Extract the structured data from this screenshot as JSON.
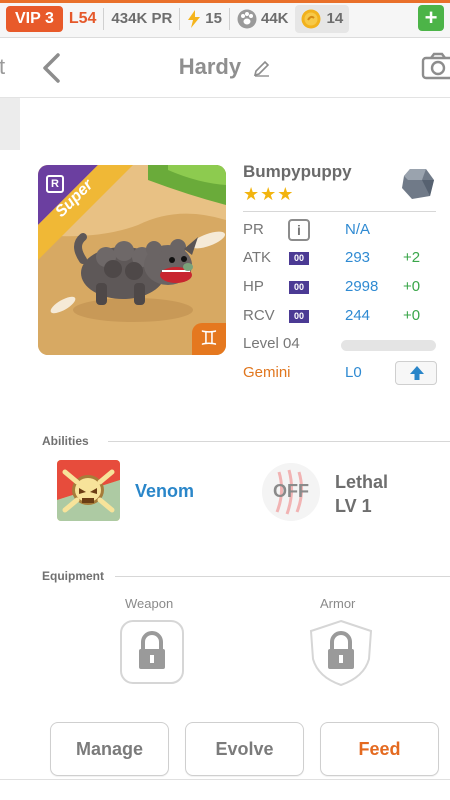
{
  "status_bar": {
    "vip_label": "VIP 3",
    "level": "L54",
    "pr": "434K PR",
    "energy": "15",
    "food": "44K",
    "coins": "14",
    "add_label": "+"
  },
  "header": {
    "partial_left": "t",
    "title": "Hardy"
  },
  "pet": {
    "badge_letter": "R",
    "rarity_label": "Super",
    "zodiac_symbol": "♊",
    "name": "Bumpypuppy",
    "stars": "★★★",
    "stats": [
      {
        "label": "PR",
        "value": "N/A",
        "bonus": ""
      },
      {
        "label": "ATK",
        "tag": "00",
        "value": "293",
        "bonus": "+2"
      },
      {
        "label": "HP",
        "tag": "00",
        "value": "2998",
        "bonus": "+0"
      },
      {
        "label": "RCV",
        "tag": "00",
        "value": "244",
        "bonus": "+0"
      }
    ],
    "level_label": "Level 04",
    "level_progress": 0.0,
    "sign_label": "Gemini",
    "sign_level": "L0",
    "info_icon_label": "i"
  },
  "abilities": {
    "heading": "Abilities",
    "items": [
      {
        "name": "Venom"
      },
      {
        "state": "OFF",
        "name": "Lethal",
        "level": "LV 1"
      }
    ]
  },
  "equipment": {
    "heading": "Equipment",
    "weapon_label": "Weapon",
    "armor_label": "Armor"
  },
  "actions": {
    "manage": "Manage",
    "evolve": "Evolve",
    "feed": "Feed"
  },
  "colors": {
    "accent_orange": "#e46a20",
    "vip_red": "#e85a2a",
    "stat_blue": "#2f8ad2",
    "bonus_green": "#3aa64a",
    "plus_green": "#4cb448",
    "tag_purple": "#4b3a94"
  }
}
